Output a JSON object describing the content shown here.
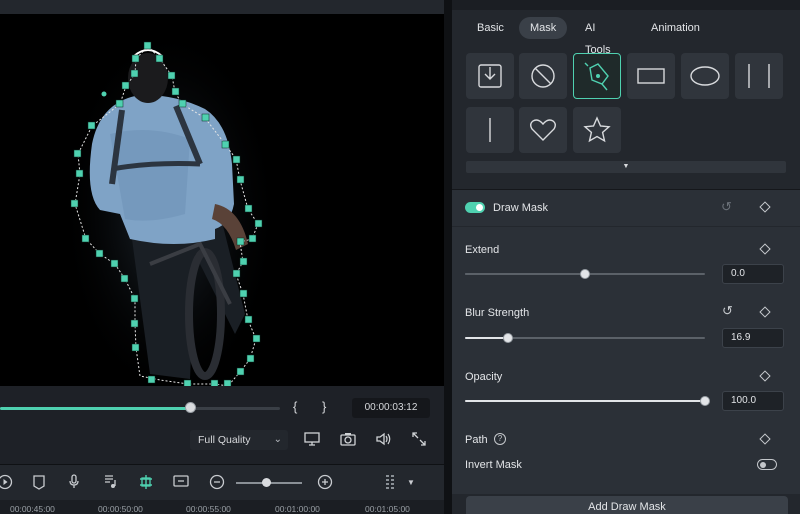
{
  "preview": {
    "timecode": "00:00:03:12",
    "progress": 0.68,
    "brace_in": "{",
    "brace_out": "}",
    "quality": "Full Quality"
  },
  "preview_tools": [
    "monitor-icon",
    "camera-icon",
    "speaker-icon",
    "fullscreen-icon"
  ],
  "timeline": {
    "ruler": [
      "00:00:45:00",
      "00:00:50:00",
      "00:00:55:00",
      "00:01:00:00",
      "00:01:05:00"
    ],
    "zoom_level": 0.45,
    "tools": [
      "play-icon",
      "shield-icon",
      "mic-icon",
      "music-icon",
      "ai-split-icon",
      "clip-icon",
      "zoom-out-icon",
      "zoom-in-icon",
      "grid-icon",
      "dropdown-icon"
    ]
  },
  "panel": {
    "tabs": [
      {
        "label": "Basic"
      },
      {
        "label": "Mask"
      },
      {
        "label": "AI Tools"
      },
      {
        "label": "Animation"
      }
    ],
    "active_tab": "Mask",
    "shapes": [
      "import-icon",
      "none-icon",
      "pen-icon",
      "rectangle-icon",
      "ellipse-icon",
      "double-line-icon",
      "single-line-icon",
      "heart-icon",
      "star-icon"
    ],
    "selected_shape": "pen-icon",
    "draw_mask": {
      "label": "Draw Mask",
      "enabled": true
    },
    "extend": {
      "label": "Extend",
      "value": "0.0",
      "level": 0.5
    },
    "blur": {
      "label": "Blur Strength",
      "value": "16.9",
      "level": 0.18
    },
    "opacity": {
      "label": "Opacity",
      "value": "100.0",
      "level": 1.0
    },
    "path": {
      "label": "Path",
      "help": "?"
    },
    "invert": {
      "label": "Invert Mask",
      "enabled": false
    },
    "add_button": "Add Draw Mask"
  },
  "colors": {
    "accent": "#4fd1b0",
    "panel": "#23272d",
    "section": "#2b3037"
  }
}
